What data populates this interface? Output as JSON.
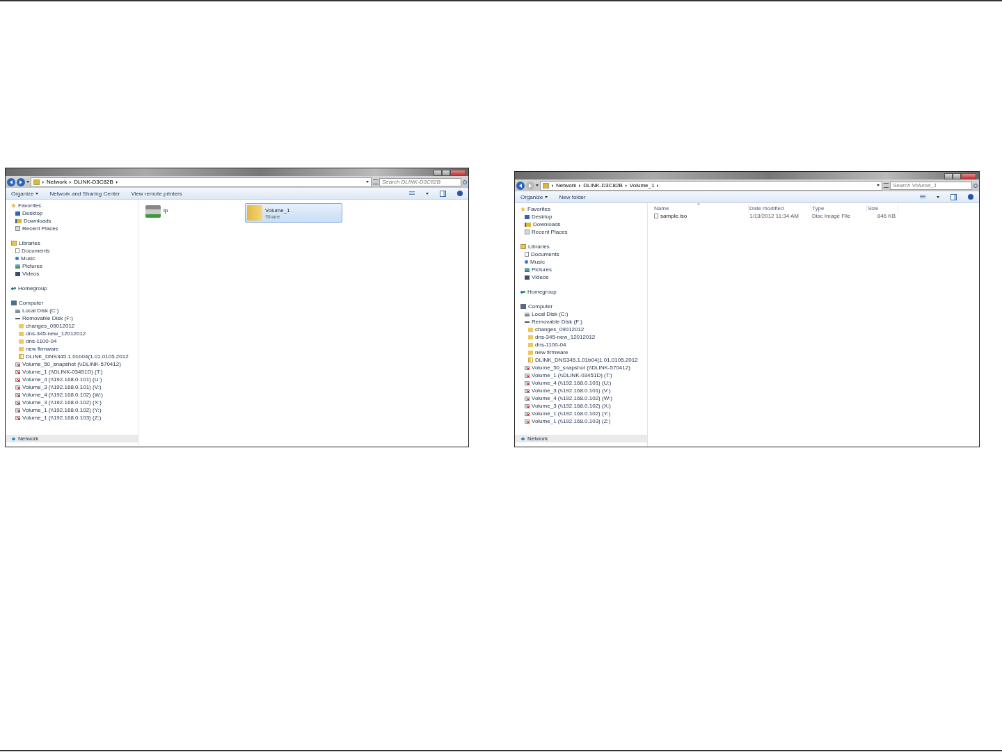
{
  "windows": [
    {
      "nav": {
        "back_enabled": true,
        "forward_enabled": true
      },
      "breadcrumb": [
        "Network",
        "DLINK-D3C82B"
      ],
      "search": {
        "placeholder": "Search DLINK-D3C82B"
      },
      "toolbar": [
        "Organize",
        "Network and Sharing Center",
        "View remote printers"
      ],
      "sidebar": [
        {
          "kind": "favorites",
          "label": "Favorites",
          "items": [
            {
              "kind": "desktop",
              "label": "Desktop"
            },
            {
              "kind": "downloads",
              "label": "Downloads"
            },
            {
              "kind": "recent",
              "label": "Recent Places"
            }
          ]
        },
        {
          "kind": "libraries",
          "label": "Libraries",
          "items": [
            {
              "kind": "documents",
              "label": "Documents"
            },
            {
              "kind": "music",
              "label": "Music"
            },
            {
              "kind": "pictures",
              "label": "Pictures"
            },
            {
              "kind": "videos",
              "label": "Videos"
            }
          ]
        },
        {
          "kind": "homegroup",
          "label": "Homegroup"
        },
        {
          "kind": "computer",
          "label": "Computer",
          "items": [
            {
              "kind": "disk",
              "label": "Local Disk (C:)"
            },
            {
              "kind": "removable",
              "label": "Removable Disk (F:)",
              "children": [
                {
                  "kind": "folder",
                  "label": "changes_09012012"
                },
                {
                  "kind": "folder",
                  "label": "dns-345-new_12012012"
                },
                {
                  "kind": "folder",
                  "label": "dns-1100-04"
                },
                {
                  "kind": "folder",
                  "label": "new firmware"
                },
                {
                  "kind": "zipfolder",
                  "label": "DLINK_DNS345.1.01b04(1.01.0105.2012"
                }
              ]
            },
            {
              "kind": "netdrive",
              "label": "Volume_50_snapshot (\\\\DLINK-570412)"
            },
            {
              "kind": "netdrive",
              "label": "Volume_1 (\\\\DLINK-03451D) (T:)"
            },
            {
              "kind": "netdrive",
              "label": "Volume_4 (\\\\192.168.0.101) (U:)"
            },
            {
              "kind": "netdrive",
              "label": "Volume_3 (\\\\192.168.0.101) (V:)"
            },
            {
              "kind": "netdrive",
              "label": "Volume_4 (\\\\192.168.0.102) (W:)"
            },
            {
              "kind": "netdrive",
              "label": "Volume_3 (\\\\192.168.0.102) (X:)"
            },
            {
              "kind": "netdrive",
              "label": "Volume_1 (\\\\192.168.0.102) (Y:)"
            },
            {
              "kind": "netdrive",
              "label": "Volume_1 (\\\\192.168.0.103) (Z:)"
            }
          ]
        },
        {
          "kind": "network",
          "label": "Network"
        }
      ],
      "content": {
        "kind": "icons",
        "items": [
          {
            "kind": "printer",
            "name": "lp",
            "selected": false
          },
          {
            "kind": "share",
            "name": "Volume_1",
            "subtitle": "Share",
            "selected": true
          }
        ]
      }
    },
    {
      "nav": {
        "back_enabled": true,
        "forward_enabled": false
      },
      "breadcrumb": [
        "Network",
        "DLINK-D3C82B",
        "Volume_1"
      ],
      "search": {
        "placeholder": "Search Volume_1"
      },
      "toolbar": [
        "Organize",
        "New folder"
      ],
      "sidebar": [
        {
          "kind": "favorites",
          "label": "Favorites",
          "items": [
            {
              "kind": "desktop",
              "label": "Desktop"
            },
            {
              "kind": "downloads",
              "label": "Downloads"
            },
            {
              "kind": "recent",
              "label": "Recent Places"
            }
          ]
        },
        {
          "kind": "libraries",
          "label": "Libraries",
          "items": [
            {
              "kind": "documents",
              "label": "Documents"
            },
            {
              "kind": "music",
              "label": "Music"
            },
            {
              "kind": "pictures",
              "label": "Pictures"
            },
            {
              "kind": "videos",
              "label": "Videos"
            }
          ]
        },
        {
          "kind": "homegroup",
          "label": "Homegroup"
        },
        {
          "kind": "computer",
          "label": "Computer",
          "items": [
            {
              "kind": "disk",
              "label": "Local Disk (C:)"
            },
            {
              "kind": "removable",
              "label": "Removable Disk (F:)",
              "children": [
                {
                  "kind": "folder",
                  "label": "changes_09012012"
                },
                {
                  "kind": "folder",
                  "label": "dns-345-new_12012012"
                },
                {
                  "kind": "folder",
                  "label": "dns-1100-04"
                },
                {
                  "kind": "folder",
                  "label": "new firmware"
                },
                {
                  "kind": "zipfolder",
                  "label": "DLINK_DNS345.1.01b04(1.01.0105.2012"
                }
              ]
            },
            {
              "kind": "netdrive",
              "label": "Volume_50_snapshot (\\\\DLINK-570412)"
            },
            {
              "kind": "netdrive",
              "label": "Volume_1 (\\\\DLINK-03451D) (T:)"
            },
            {
              "kind": "netdrive",
              "label": "Volume_4 (\\\\192.168.0.101) (U:)"
            },
            {
              "kind": "netdrive",
              "label": "Volume_3 (\\\\192.168.0.101) (V:)"
            },
            {
              "kind": "netdrive",
              "label": "Volume_4 (\\\\192.168.0.102) (W:)"
            },
            {
              "kind": "netdrive",
              "label": "Volume_3 (\\\\192.168.0.102) (X:)"
            },
            {
              "kind": "netdrive",
              "label": "Volume_1 (\\\\192.168.0.102) (Y:)"
            },
            {
              "kind": "netdrive",
              "label": "Volume_1 (\\\\192.168.0.103) (Z:)"
            }
          ]
        },
        {
          "kind": "network",
          "label": "Network"
        }
      ],
      "content": {
        "kind": "details",
        "columns": [
          "Name",
          "Date modified",
          "Type",
          "Size"
        ],
        "rows": [
          {
            "kind": "disc-image",
            "cells": [
              "sample.iso",
              "1/13/2012 11:34 AM",
              "Disc Image File",
              "846 KB"
            ]
          }
        ]
      }
    }
  ]
}
